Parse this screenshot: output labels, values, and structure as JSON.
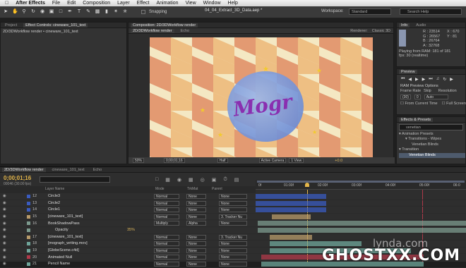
{
  "menubar": {
    "apple": "",
    "app": "After Effects",
    "items": [
      "File",
      "Edit",
      "Composition",
      "Layer",
      "Effect",
      "Animation",
      "View",
      "Window",
      "Help"
    ]
  },
  "toolbar": {
    "snapping": "Snapping",
    "document": "04_04_Extract_3D_Data.aep *",
    "workspace_label": "Workspace:",
    "workspace_value": "Standard",
    "search_placeholder": "Search Help"
  },
  "project_panel": {
    "tabs": [
      "Project",
      "Effect Controls: cineware_101_text"
    ],
    "path": "2D/3DWorkflow render • cineware_101_text"
  },
  "composition_panel": {
    "title": "Composition: 2D/3DWorkflow render",
    "subtabs": [
      "2D/3DWorkflow render",
      "Echo"
    ],
    "renderer_label": "Renderer:",
    "renderer_value": "Classic 3D",
    "logo_text": "Mogr",
    "zoom": "50%",
    "timecode": "0;00;01;16",
    "resolution": "Half",
    "camera": "Active Camera",
    "view": "1 View",
    "exposure": "+0.0"
  },
  "info_panel": {
    "tabs": [
      "Info",
      "Audio"
    ],
    "R": "23514",
    "G": "26567",
    "B": "26764",
    "A": "32768",
    "X": "670",
    "Y": "81",
    "playing": "Playing from RAM: 181 of 181",
    "fps": "fps: 30 (realtime)"
  },
  "preview_panel": {
    "title": "Preview",
    "options": "RAM Preview Options",
    "frame_rate_label": "Frame Rate",
    "skip_label": "Skip",
    "resolution_label": "Resolution",
    "frame_rate": "(30)",
    "skip": "0",
    "resolution": "Auto",
    "from_current": "From Current Time",
    "full_screen": "Full Screen"
  },
  "effects_panel": {
    "title": "Effects & Presets",
    "search": "venetian",
    "items": [
      "Animation Presets",
      "Transitions - Wipes",
      "Venetian Blinds",
      "Transition",
      "Venetian Blinds"
    ]
  },
  "timeline": {
    "tabs": [
      "2D/3DWorkflow render",
      "cineware_101_text",
      "Echo"
    ],
    "timecode": "0;00;01;16",
    "frame": "00046 (30.00 fps)",
    "columns": {
      "name": "Layer Name",
      "mode": "Mode",
      "trkmat": "TrkMat",
      "parent": "Parent"
    },
    "ruler": [
      "0f",
      "01:00f",
      "02:00f",
      "03:00f",
      "04:00f",
      "05:00f",
      "06:0"
    ],
    "layers": [
      {
        "num": "12",
        "name": "Circle3",
        "mode": "Normal",
        "trk": "None",
        "parent": "None",
        "color": "#3a5bbf"
      },
      {
        "num": "13",
        "name": "Circle2",
        "mode": "Normal",
        "trk": "None",
        "parent": "None",
        "color": "#3a5bbf"
      },
      {
        "num": "14",
        "name": "Circle1",
        "mode": "Normal",
        "trk": "None",
        "parent": "None",
        "color": "#3a5bbf"
      },
      {
        "num": "15",
        "name": "[cineware_101_text]",
        "mode": "Normal",
        "trk": "None",
        "parent": "3. Tracker Nu",
        "color": "#b79a6a"
      },
      {
        "num": "16",
        "name": "BookShadowPass",
        "mode": "Multiply",
        "trk": "Alpha",
        "parent": "None",
        "color": "#7c9a8e"
      },
      {
        "num": "",
        "name": "Opacity",
        "mode": "",
        "trk": "",
        "parent": "",
        "color": "#7c9a8e",
        "sub": "35%"
      },
      {
        "num": "17",
        "name": "[cineware_101_text]",
        "mode": "Normal",
        "trk": "None",
        "parent": "3. Tracker Nu",
        "color": "#b79a6a"
      },
      {
        "num": "18",
        "name": "[mograph_writing.mov]",
        "mode": "Normal",
        "trk": "None",
        "parent": "None",
        "color": "#6fa59a"
      },
      {
        "num": "19",
        "name": "[GlobeScene.c4d]",
        "mode": "Normal",
        "trk": "None",
        "parent": "None",
        "color": "#6fa59a"
      },
      {
        "num": "20",
        "name": "Animated Null",
        "mode": "Normal",
        "trk": "None",
        "parent": "None",
        "color": "#b0394a"
      },
      {
        "num": "21",
        "name": "Pencil Name",
        "mode": "Normal",
        "trk": "None",
        "parent": "None",
        "color": "#6fa59a"
      }
    ]
  },
  "watermark": {
    "lynda": "lynda.com",
    "ghost": "GHOSTXX.COM"
  }
}
